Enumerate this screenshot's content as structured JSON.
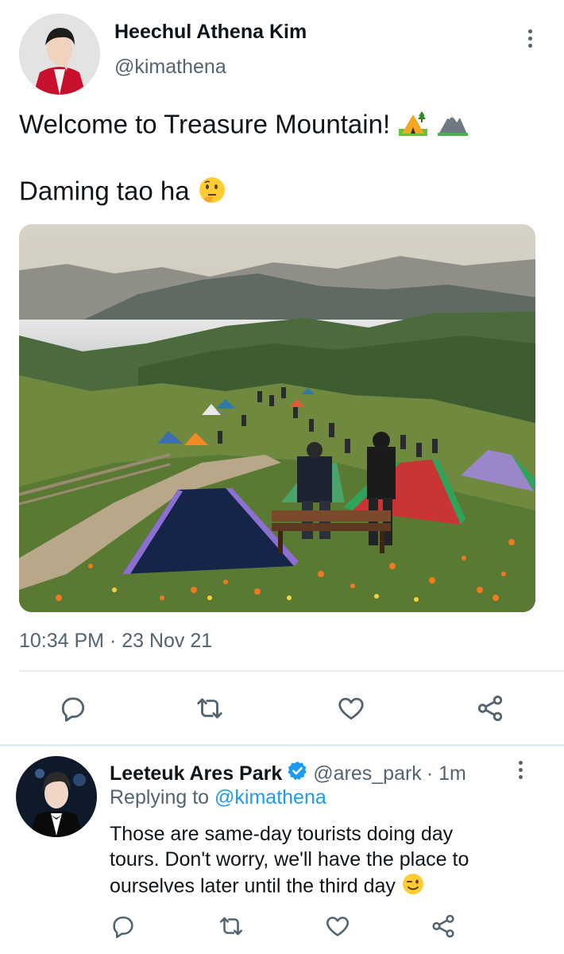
{
  "tweet": {
    "author": {
      "name": "Heechul Athena Kim",
      "handle": "@kimathena"
    },
    "text_line1": "Welcome to Treasure Mountain!",
    "text_line1_emojis": [
      "camping-tent-emoji",
      "mountain-emoji"
    ],
    "text_line2": "Daming tao ha",
    "text_line2_emojis": [
      "thinking-face-emoji"
    ],
    "image_alt": "Campers and tents on a grassy mountaintop with a sea of clouds below",
    "timestamp": "10:34 PM · 23 Nov 21",
    "actions": [
      "reply-icon",
      "retweet-icon",
      "like-icon",
      "share-icon"
    ]
  },
  "reply": {
    "author": {
      "name": "Leeteuk Ares Park",
      "verified": true,
      "handle": "@ares_park",
      "time": "· 1m"
    },
    "replying_prefix": "Replying to",
    "replying_handle": "@kimathena",
    "text_line1": "Those are same-day tourists doing day",
    "text_line2": "tours. Don't worry, we'll have the place to",
    "text_line3": "ourselves later until the third day",
    "text_emojis": [
      "winking-face-emoji"
    ],
    "actions": [
      "reply-icon",
      "retweet-icon",
      "like-icon",
      "share-icon"
    ]
  },
  "colors": {
    "accent": "#1d9bf0",
    "muted": "#536471",
    "divider": "#e6ecf0",
    "icon": "#536471"
  }
}
